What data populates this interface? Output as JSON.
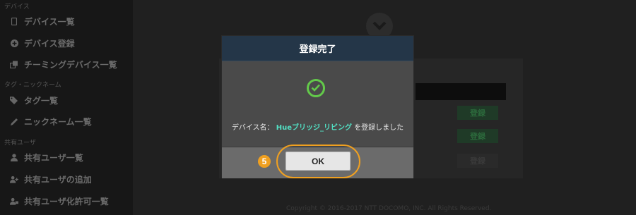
{
  "sidebar": {
    "section_devices": "デバイス",
    "items_devices": [
      {
        "label": "デバイス一覧",
        "icon": "phone-icon"
      },
      {
        "label": "デバイス登録",
        "icon": "plus-circle-icon"
      },
      {
        "label": "チーミングデバイス一覧",
        "icon": "clone-icon"
      }
    ],
    "section_tags": "タグ・ニックネーム",
    "items_tags": [
      {
        "label": "タグ一覧",
        "icon": "tags-icon"
      },
      {
        "label": "ニックネーム一覧",
        "icon": "pencil-icon"
      }
    ],
    "section_shared": "共有ユーザ",
    "items_shared": [
      {
        "label": "共有ユーザ一覧",
        "icon": "user-icon"
      },
      {
        "label": "共有ユーザの追加",
        "icon": "user-plus-icon"
      },
      {
        "label": "共有ユーザ化許可一覧",
        "icon": "user-lock-icon"
      }
    ]
  },
  "background": {
    "register_label": "登録",
    "footer": "Copyright © 2016-2017 NTT DOCOMO, INC. All Rights Reserved."
  },
  "modal": {
    "title": "登録完了",
    "message_prefix": "デバイス名：",
    "device_name": "Hueブリッジ_リビング",
    "message_suffix": "を登録しました",
    "ok_label": "OK"
  },
  "annotation": {
    "step_number": "5",
    "highlight_color": "#f0a020"
  },
  "colors": {
    "modal_header": "#243648",
    "success_green": "#63c94a",
    "device_name_color": "#52e0c4"
  }
}
